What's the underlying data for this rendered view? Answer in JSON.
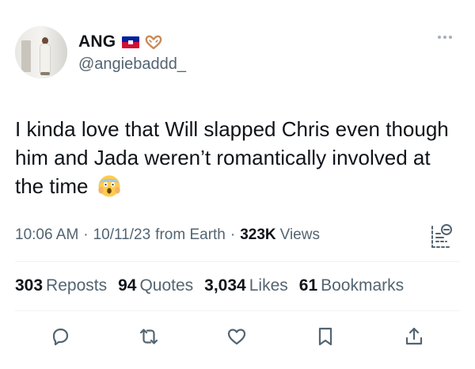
{
  "author": {
    "display_name": "ANG",
    "handle": "@angiebaddd_",
    "flag": "haiti-flag",
    "emoji": "heart-hands"
  },
  "tweet": {
    "text": "I kinda love that Will slapped Chris even though him and Jada weren’t romantically involved at the time",
    "emoji": "face-screaming-in-fear"
  },
  "meta": {
    "time": "10:06 AM",
    "date": "10/11/23",
    "source": "from Earth",
    "views_count": "323K",
    "views_label": "Views"
  },
  "stats": {
    "reposts_count": "303",
    "reposts_label": "Reposts",
    "quotes_count": "94",
    "quotes_label": "Quotes",
    "likes_count": "3,034",
    "likes_label": "Likes",
    "bookmarks_count": "61",
    "bookmarks_label": "Bookmarks"
  },
  "actions": [
    "reply-icon",
    "repost-icon",
    "like-icon",
    "bookmark-icon",
    "share-icon"
  ],
  "colors": {
    "text": "#0f1419",
    "secondary": "#536471",
    "divider": "#eff3f4",
    "flag_blue": "#00209f",
    "flag_red": "#d21034"
  }
}
